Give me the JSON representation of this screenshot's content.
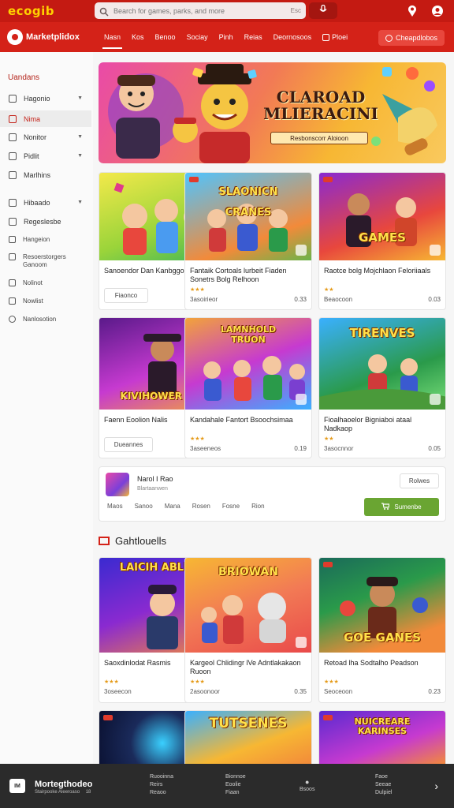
{
  "header": {
    "logo": "ecogib",
    "search_placeholder": "Bearch for games, parks, and more",
    "search_clear": "Esc"
  },
  "nav": {
    "brand": "Marketplidox",
    "items": [
      "Nasn",
      "Kos",
      "Benoo",
      "Sociay",
      "Pinh",
      "Reias",
      "Deornosoos",
      "Ploei"
    ],
    "active_index": 0,
    "cta": "Cheapdlobos"
  },
  "sidebar": {
    "title": "Uandans",
    "items": [
      {
        "label": "Hagonio",
        "chevron": true,
        "active": false
      },
      {
        "label": "Nima",
        "chevron": false,
        "active": true
      },
      {
        "label": "Nonitor",
        "chevron": true,
        "active": false
      },
      {
        "label": "Pidlit",
        "chevron": true,
        "active": false
      },
      {
        "label": "Marlhins",
        "chevron": false,
        "active": false
      },
      {
        "label": "Hibaado",
        "chevron": true,
        "active": false
      },
      {
        "label": "Regeslesbe",
        "chevron": false,
        "active": false
      },
      {
        "label": "Hangeion",
        "chevron": false,
        "active": false
      },
      {
        "label": "Resoerstorgers Ganoom",
        "chevron": false,
        "active": false
      },
      {
        "label": "Nolinot",
        "chevron": false,
        "active": false
      },
      {
        "label": "Nowlist",
        "chevron": false,
        "active": false
      },
      {
        "label": "Nanlosotion",
        "chevron": false,
        "active": false
      }
    ]
  },
  "hero": {
    "title": "CLAROAD MLIERACINI",
    "subtitle": "Resbonscorr Aloioon"
  },
  "cards": [
    {
      "title": "Sanoendor Dan Kanbggon",
      "stars": "",
      "meta_left": "",
      "meta_right": "",
      "button": "Fiaonco",
      "overlay": ""
    },
    {
      "title": "Fantaik Cortoals lurbeit Fiaden Sonetrs Bolg Relhoon",
      "stars": "★★★",
      "meta_left": "3asoirieor",
      "meta_right": "0.33",
      "button": "",
      "overlay": "SLAONICN CRANES"
    },
    {
      "title": "Raotce bolg Mojchlaon Feloriiaals",
      "stars": "★★",
      "meta_left": "Beaocoon",
      "meta_right": "0.03",
      "button": "",
      "overlay": "GAMES"
    },
    {
      "title": "Faenn Eoolion Nalis",
      "stars": "",
      "meta_left": "",
      "meta_right": "",
      "button": "Dueannes",
      "overlay": "KIVIHOWER GID"
    },
    {
      "title": "Kandahale Fantort Bsoochsimaa",
      "stars": "★★★",
      "meta_left": "3aseeneos",
      "meta_right": "0.19",
      "button": "",
      "overlay": "LAMNHOLD TRUON"
    },
    {
      "title": "Fioalhaoelor Bigniaboi ataal Nadkaop",
      "stars": "★★",
      "meta_left": "3asocnnor",
      "meta_right": "0.05",
      "button": "",
      "overlay": "TIRENVES"
    }
  ],
  "featured": {
    "name": "Narol I Rao",
    "sub": "Blartaanwen",
    "button": "Rolwes",
    "tabs": [
      "Maos",
      "Sanoo",
      "Mana",
      "Rosen",
      "Fosne",
      "Rion"
    ],
    "cta": "Sumenbe"
  },
  "section": {
    "title": "Gahtlouells"
  },
  "cards2": [
    {
      "title": "Saoxdinlodat Rasmis",
      "stars": "★★★",
      "meta_left": "3oseecon",
      "meta_right": "11",
      "overlay": "LAICIH ABLEES"
    },
    {
      "title": "Kargeol Chlidingr lVe Adntlakakaon Ruoon",
      "stars": "★★★",
      "meta_left": "2asoonoor",
      "meta_right": "0.35",
      "overlay": "BRIOWAN"
    },
    {
      "title": "Retoad lha Sodtalho Peadson",
      "stars": "★★★",
      "meta_left": "Seoceoon",
      "meta_right": "0.23",
      "overlay": "GOE GANES"
    }
  ],
  "cards3": [
    {
      "overlay": ""
    },
    {
      "overlay": "TUTSENES"
    },
    {
      "overlay": "NUICREARE KARINSES"
    }
  ],
  "footer": {
    "logo_short": "IM",
    "brand": "Mortegthodeo",
    "brand_sub": "Stairpooke Aleeroaso",
    "small_num": "18",
    "col1": [
      "Ruooinna",
      "Reirs",
      "Reaoo"
    ],
    "col2": [
      "Bionnoe",
      "Eoolie",
      "Fiaan"
    ],
    "col3": [
      "Bsoos"
    ],
    "col4": [
      "Faoe",
      "Seeae",
      "Dulpiel"
    ]
  },
  "colors": {
    "brand_red": "#c41a12",
    "nav_red": "#d42218",
    "cta_green": "#6aa532",
    "star": "#e59b1a",
    "footer": "#2b2b2b"
  }
}
